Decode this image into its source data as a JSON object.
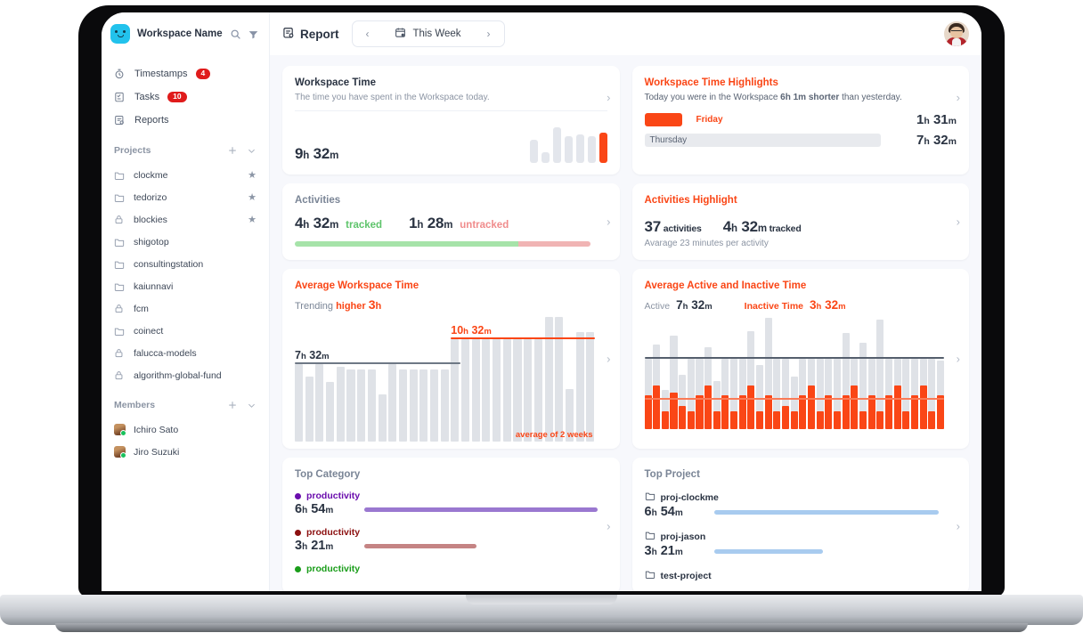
{
  "colors": {
    "accent": "#fa4616",
    "text": "#2a3342",
    "muted": "#8b94a3",
    "bar_gray": "#dfe2e7"
  },
  "sidebar": {
    "workspace_name": "Workspace Name",
    "search_icon": "search-icon",
    "filter_icon": "filter-icon",
    "nav": [
      {
        "label": "Timestamps",
        "icon": "timer-icon",
        "badge": "4"
      },
      {
        "label": "Tasks",
        "icon": "task-icon",
        "badge": "10"
      },
      {
        "label": "Reports",
        "icon": "report-icon",
        "badge": ""
      }
    ],
    "projects_group": {
      "title": "Projects",
      "add_icon": "plus-icon",
      "collapse_icon": "chevron-down-icon"
    },
    "projects": [
      {
        "name": "clockme",
        "icon": "folder-icon",
        "starred": true
      },
      {
        "name": "tedorizo",
        "icon": "folder-icon",
        "starred": true
      },
      {
        "name": "blockies",
        "icon": "lock-icon",
        "starred": true
      },
      {
        "name": "shigotop",
        "icon": "folder-icon",
        "starred": false
      },
      {
        "name": "consultingstation",
        "icon": "folder-icon",
        "starred": false
      },
      {
        "name": "kaiunnavi",
        "icon": "folder-icon",
        "starred": false
      },
      {
        "name": "fcm",
        "icon": "lock-icon",
        "starred": false
      },
      {
        "name": "coinect",
        "icon": "folder-icon",
        "starred": false
      },
      {
        "name": "falucca-models",
        "icon": "lock-icon",
        "starred": false
      },
      {
        "name": "algorithm-global-fund",
        "icon": "lock-icon",
        "starred": false
      }
    ],
    "members_group": {
      "title": "Members",
      "add_icon": "plus-icon",
      "collapse_icon": "chevron-down-icon"
    },
    "members": [
      {
        "name": "Ichiro Sato"
      },
      {
        "name": "Jiro Suzuki"
      }
    ]
  },
  "topbar": {
    "report_icon": "report-icon",
    "report_label": "Report",
    "prev_icon": "chevron-left-icon",
    "next_icon": "chevron-right-icon",
    "calendar_icon": "calendar-icon",
    "date_range": "This Week",
    "avatar": "user-avatar"
  },
  "cards": {
    "workspace_time": {
      "title": "Workspace Time",
      "subtitle": "The time you have spent in the Workspace today.",
      "value": "9",
      "unit_h": "h",
      "minutes": "32",
      "unit_m": "m",
      "chevron": "chevron-right-icon"
    },
    "workspace_time_highlights": {
      "title": "Workspace Time Highlights",
      "sentence_pre": "Today you were in the Workspace ",
      "sentence_bold": "6h 1m shorter",
      "sentence_post": " than yesterday.",
      "rows": [
        {
          "day": "Friday",
          "hours": "1",
          "minutes": "31",
          "highlight": true
        },
        {
          "day": "Thursday",
          "hours": "7",
          "minutes": "32",
          "highlight": false
        }
      ],
      "chevron": "chevron-right-icon"
    },
    "activities": {
      "title": "Activities",
      "tracked_value": "4",
      "tracked_minutes": "32",
      "tracked_label": "tracked",
      "untracked_value": "1",
      "untracked_minutes": "28",
      "untracked_label": "untracked",
      "chevron": "chevron-right-icon"
    },
    "activities_highlight": {
      "title": "Activities Highlight",
      "count": "37",
      "count_label": "activities",
      "tracked_h": "4",
      "tracked_m": "32",
      "tracked_label": "tracked",
      "subtitle": "Avarage 23 minutes per activity",
      "chevron": "chevron-right-icon"
    },
    "average_workspace_time": {
      "title": "Average Workspace Time",
      "trend_pre": "Trending ",
      "trend_word": "higher",
      "trend_number": "3",
      "trend_unit": "h",
      "baseline_label_h": "7",
      "baseline_label_m": "32",
      "current_label_h": "10",
      "current_label_m": "32",
      "footnote": "average of 2 weeks",
      "chevron": "chevron-right-icon"
    },
    "average_active_inactive": {
      "title": "Average Active and Inactive Time",
      "active_label": "Active",
      "active_h": "7",
      "active_m": "32",
      "inactive_label": "Inactive Time",
      "inactive_h": "3",
      "inactive_m": "32",
      "chevron": "chevron-right-icon"
    },
    "top_category": {
      "title": "Top Category",
      "chevron": "chevron-right-icon",
      "items": [
        {
          "name": "productivity",
          "hours": "6",
          "minutes": "54",
          "color": "#6a0dad",
          "bar_color": "#9a78d0",
          "bar_pct": 100
        },
        {
          "name": "productivity",
          "hours": "3",
          "minutes": "21",
          "color": "#8c1010",
          "bar_color": "#c58484",
          "bar_pct": 48
        },
        {
          "name": "productivity",
          "hours": "",
          "minutes": "",
          "color": "#1a9d1a",
          "bar_color": "#8fd08f",
          "bar_pct": 30
        }
      ]
    },
    "top_project": {
      "title": "Top Project",
      "chevron": "chevron-right-icon",
      "items": [
        {
          "name": "proj-clockme",
          "icon": "folder-icon",
          "hours": "6",
          "minutes": "54",
          "bar_color": "#a8cbef",
          "bar_pct": 100
        },
        {
          "name": "proj-jason",
          "icon": "folder-icon",
          "hours": "3",
          "minutes": "21",
          "bar_color": "#a8cbef",
          "bar_pct": 48
        },
        {
          "name": "test-project",
          "icon": "folder-icon",
          "hours": "",
          "minutes": "",
          "bar_color": "#a8cbef",
          "bar_pct": 30
        }
      ]
    }
  },
  "chart_data": [
    {
      "type": "bar",
      "id": "workspace-time-mini",
      "title": "Workspace Time",
      "categories": [
        "d1",
        "d2",
        "d3",
        "d4",
        "d5",
        "d6",
        "d7"
      ],
      "values": [
        26,
        12,
        40,
        30,
        32,
        30,
        34
      ],
      "highlight_index": 6,
      "ylabel": "hours",
      "xlabel": "",
      "grid": false,
      "legend": "none"
    },
    {
      "type": "bar",
      "id": "workspace-time-highlights",
      "title": "Workspace Time Highlights",
      "categories": [
        "Friday",
        "Thursday"
      ],
      "values": [
        1.52,
        7.53
      ],
      "value_labels": [
        "1h 31m",
        "7h 32m"
      ],
      "ylabel": "",
      "xlabel": "",
      "grid": false,
      "legend": "none"
    },
    {
      "type": "bar",
      "id": "activities-split",
      "title": "Activities",
      "categories": [
        "tracked",
        "untracked"
      ],
      "values": [
        4.53,
        1.47
      ],
      "value_labels": [
        "4h 32m",
        "1h 28m"
      ],
      "ylabel": "",
      "xlabel": "",
      "grid": false,
      "legend": "none"
    },
    {
      "type": "bar",
      "id": "average-workspace-time",
      "title": "Average Workspace Time",
      "categories": [
        "1",
        "2",
        "3",
        "4",
        "5",
        "6",
        "7",
        "8",
        "9",
        "10",
        "11",
        "12",
        "13",
        "14",
        "15",
        "16",
        "17",
        "18",
        "19",
        "20",
        "21",
        "22",
        "23",
        "24",
        "25",
        "26",
        "27",
        "28"
      ],
      "values": [
        62,
        52,
        62,
        48,
        60,
        58,
        58,
        58,
        38,
        62,
        58,
        58,
        58,
        58,
        58,
        82,
        82,
        82,
        82,
        82,
        82,
        82,
        82,
        82,
        100,
        108,
        42,
        88,
        88
      ],
      "ylim": [
        0,
        110
      ],
      "annotations": [
        {
          "label": "7h 32m",
          "type": "hline",
          "value": 62,
          "span": "first-half",
          "color": "#6e7885"
        },
        {
          "label": "10h 32m",
          "type": "hline",
          "value": 82,
          "span": "second-half",
          "color": "#fa4616"
        },
        {
          "label": "average of 2 weeks",
          "type": "footnote",
          "color": "#fa4616"
        }
      ],
      "ylabel": "",
      "xlabel": "",
      "grid": false,
      "legend": "none"
    },
    {
      "type": "bar",
      "id": "average-active-inactive",
      "title": "Average Active and Inactive Time",
      "categories": [
        "1",
        "2",
        "3",
        "4",
        "5",
        "6",
        "7",
        "8",
        "9",
        "10",
        "11",
        "12",
        "13",
        "14",
        "15",
        "16",
        "17",
        "18",
        "19",
        "20",
        "21",
        "22",
        "23",
        "24",
        "25",
        "26",
        "27",
        "28",
        "29",
        "30",
        "31",
        "32",
        "33",
        "34",
        "35"
      ],
      "series": [
        {
          "name": "Active",
          "color": "#dfe2e7",
          "values": [
            62,
            74,
            34,
            82,
            48,
            62,
            62,
            72,
            42,
            62,
            62,
            62,
            86,
            56,
            98,
            62,
            62,
            46,
            62,
            62,
            62,
            62,
            62,
            84,
            62,
            76,
            62,
            96,
            62,
            62,
            62,
            62,
            62,
            62,
            60
          ]
        },
        {
          "name": "Inactive Time",
          "color": "#fa4616",
          "values": [
            30,
            38,
            16,
            32,
            20,
            16,
            30,
            38,
            16,
            30,
            16,
            30,
            38,
            16,
            30,
            16,
            20,
            16,
            30,
            38,
            16,
            30,
            16,
            30,
            38,
            16,
            30,
            16,
            30,
            38,
            16,
            30,
            38,
            16,
            30
          ]
        }
      ],
      "annotations": [
        {
          "label": "Active 7h 32m",
          "type": "hline",
          "value": 62,
          "color": "#555f6d"
        },
        {
          "label": "Inactive Time 3h 32m",
          "type": "hline",
          "value": 26,
          "color": "#fa7a56"
        }
      ],
      "ylim": [
        0,
        100
      ],
      "ylabel": "",
      "xlabel": "",
      "grid": false,
      "legend": "top"
    },
    {
      "type": "bar",
      "id": "top-category",
      "title": "Top Category",
      "orientation": "horizontal",
      "categories": [
        "productivity",
        "productivity",
        "productivity"
      ],
      "values": [
        6.9,
        3.35,
        2.0
      ],
      "value_labels": [
        "6h 54m",
        "3h 21m",
        ""
      ],
      "colors": [
        "#9a78d0",
        "#c58484",
        "#8fd08f"
      ],
      "ylabel": "",
      "xlabel": "",
      "grid": false,
      "legend": "none"
    },
    {
      "type": "bar",
      "id": "top-project",
      "title": "Top Project",
      "orientation": "horizontal",
      "categories": [
        "proj-clockme",
        "proj-jason",
        "test-project"
      ],
      "values": [
        6.9,
        3.35,
        2.0
      ],
      "value_labels": [
        "6h 54m",
        "3h 21m",
        ""
      ],
      "colors": [
        "#a8cbef",
        "#a8cbef",
        "#a8cbef"
      ],
      "ylabel": "",
      "xlabel": "",
      "grid": false,
      "legend": "none"
    }
  ]
}
